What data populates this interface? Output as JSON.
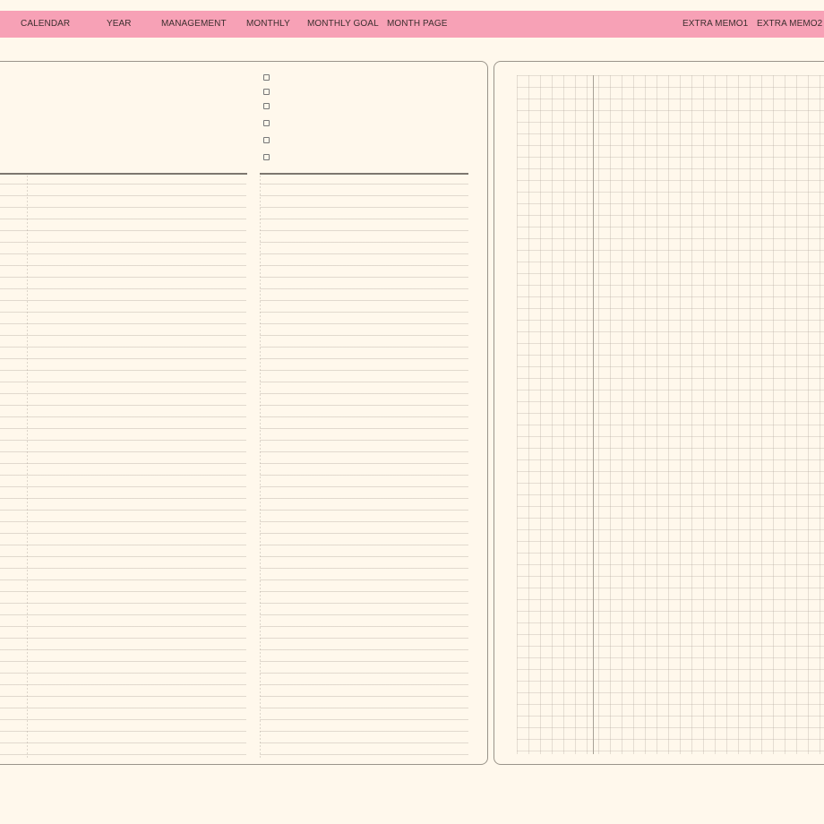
{
  "nav": {
    "tabs": [
      {
        "label": "CALENDAR"
      },
      {
        "label": "YEAR"
      },
      {
        "label": "MANAGEMENT"
      },
      {
        "label": "MONTHLY"
      },
      {
        "label": "MONTHLY GOAL"
      },
      {
        "label": "MONTH PAGE"
      },
      {
        "label": "EXTRA MEMO1"
      },
      {
        "label": "EXTRA MEMO2"
      }
    ]
  },
  "checklist": {
    "items": 6,
    "checked": [
      false,
      false,
      false,
      false,
      false,
      false
    ]
  },
  "colors": {
    "nav_background": "#f7a1b6",
    "page_background": "#fff8ec",
    "panel_border": "#9a948a"
  }
}
